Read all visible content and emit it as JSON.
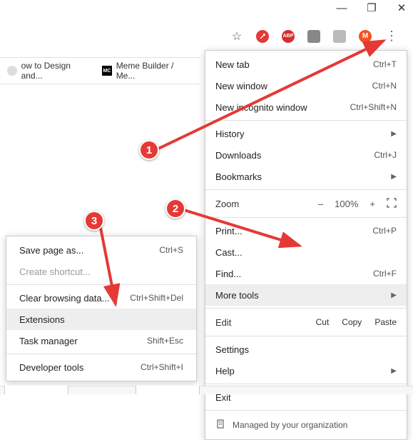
{
  "window": {
    "minimize": "—",
    "maximize": "❐",
    "close": "✕"
  },
  "toolbar": {
    "star_title": "Bookmark",
    "avatar_letter": "M"
  },
  "bookmarks": {
    "item1": "ow to Design and...",
    "item2_badge": "MC",
    "item2": "Meme Builder / Me..."
  },
  "menu": {
    "newTab": {
      "label": "New tab",
      "shortcut": "Ctrl+T"
    },
    "newWindow": {
      "label": "New window",
      "shortcut": "Ctrl+N"
    },
    "incognito": {
      "label": "New incognito window",
      "shortcut": "Ctrl+Shift+N"
    },
    "history": {
      "label": "History"
    },
    "downloads": {
      "label": "Downloads",
      "shortcut": "Ctrl+J"
    },
    "bookmarks": {
      "label": "Bookmarks"
    },
    "zoom": {
      "label": "Zoom",
      "minus": "–",
      "value": "100%",
      "plus": "+"
    },
    "print": {
      "label": "Print...",
      "shortcut": "Ctrl+P"
    },
    "cast": {
      "label": "Cast..."
    },
    "find": {
      "label": "Find...",
      "shortcut": "Ctrl+F"
    },
    "moreTools": {
      "label": "More tools"
    },
    "edit": {
      "label": "Edit",
      "cut": "Cut",
      "copy": "Copy",
      "paste": "Paste"
    },
    "settings": {
      "label": "Settings"
    },
    "help": {
      "label": "Help"
    },
    "exit": {
      "label": "Exit"
    },
    "org": {
      "label": "Managed by your organization"
    }
  },
  "submenu": {
    "savePage": {
      "label": "Save page as...",
      "shortcut": "Ctrl+S"
    },
    "createShortcut": {
      "label": "Create shortcut..."
    },
    "clearData": {
      "label": "Clear browsing data...",
      "shortcut": "Ctrl+Shift+Del"
    },
    "extensions": {
      "label": "Extensions"
    },
    "taskManager": {
      "label": "Task manager",
      "shortcut": "Shift+Esc"
    },
    "devTools": {
      "label": "Developer tools",
      "shortcut": "Ctrl+Shift+I"
    }
  },
  "annotations": {
    "step1": "1",
    "step2": "2",
    "step3": "3"
  }
}
